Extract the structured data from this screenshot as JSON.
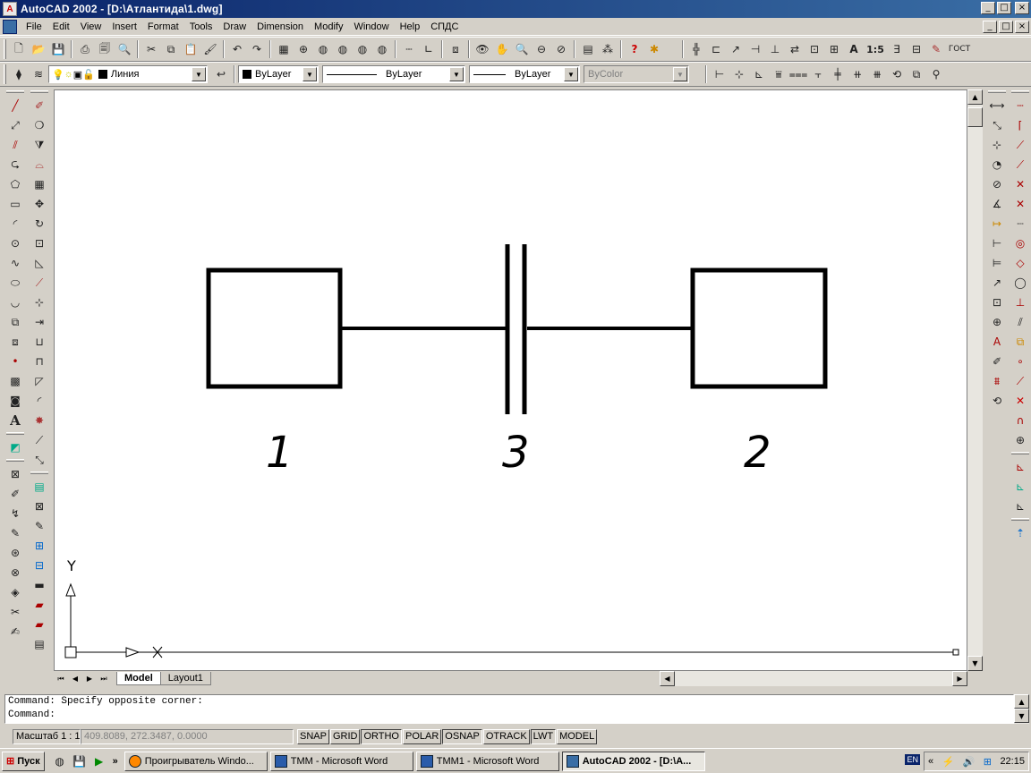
{
  "window": {
    "title": "AutoCAD 2002 - [D:\\Атлантида\\1.dwg]",
    "controls": {
      "minimize": "_",
      "maximize": "□",
      "close": "×"
    }
  },
  "menu": [
    "File",
    "Edit",
    "View",
    "Insert",
    "Format",
    "Tools",
    "Draw",
    "Dimension",
    "Modify",
    "Window",
    "Help",
    "СПДС"
  ],
  "toolbar_properties": {
    "layer": "Линия",
    "color": "ByLayer",
    "linetype": "ByLayer",
    "lineweight": "ByLayer",
    "plotstyle": "ByColor"
  },
  "standard_toolbar_extras": {
    "scale_label": "1:5",
    "gost_label": "ГОСТ"
  },
  "drawing": {
    "labels": [
      "1",
      "3",
      "2"
    ],
    "ucs": {
      "y_label": "Y",
      "x_label": "X"
    }
  },
  "tabs": [
    "Model",
    "Layout1"
  ],
  "active_tab": "Model",
  "command_lines": [
    "Command: Specify opposite corner:",
    "Command:"
  ],
  "status": {
    "scale": "Масштаб 1 : 1",
    "coordinates": "409.8089, 272.3487, 0.0000",
    "toggles": [
      {
        "label": "SNAP",
        "on": false
      },
      {
        "label": "GRID",
        "on": false
      },
      {
        "label": "ORTHO",
        "on": true
      },
      {
        "label": "POLAR",
        "on": false
      },
      {
        "label": "OSNAP",
        "on": true
      },
      {
        "label": "OTRACK",
        "on": false
      },
      {
        "label": "LWT",
        "on": true
      },
      {
        "label": "MODEL",
        "on": false
      }
    ]
  },
  "taskbar": {
    "start": "Пуск",
    "tasks": [
      {
        "label": "Проигрыватель Windo...",
        "active": false
      },
      {
        "label": "ТММ - Microsoft Word",
        "active": false
      },
      {
        "label": "ТММ1 - Microsoft Word",
        "active": false
      },
      {
        "label": "AutoCAD 2002 - [D:\\A...",
        "active": true
      }
    ],
    "more": "»",
    "lang": "EN",
    "clock": "22:15"
  },
  "colors": {
    "titlebar_start": "#0a246a",
    "titlebar_end": "#3a6ea5",
    "chrome": "#d4d0c8",
    "canvas": "#ffffff"
  }
}
